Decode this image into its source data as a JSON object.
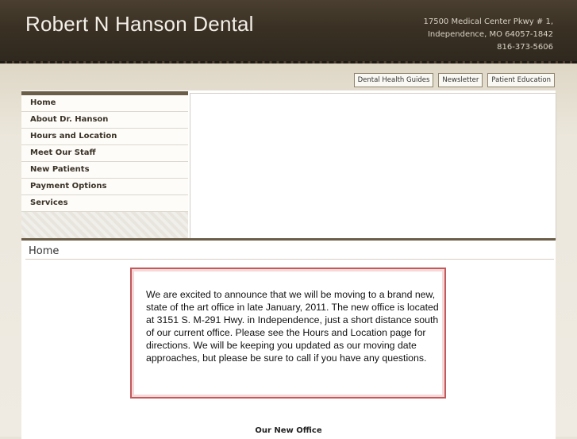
{
  "header": {
    "site_title": "Robert N Hanson Dental",
    "address_line1": "17500 Medical Center Pkwy # 1,",
    "address_line2": "Independence, MO 64057-1842",
    "phone": "816-373-5606"
  },
  "top_links": [
    {
      "label": "Dental Health Guides"
    },
    {
      "label": "Newsletter"
    },
    {
      "label": "Patient Education"
    }
  ],
  "nav": {
    "items": [
      {
        "label": "Home"
      },
      {
        "label": "About Dr. Hanson"
      },
      {
        "label": "Hours and Location"
      },
      {
        "label": "Meet Our Staff"
      },
      {
        "label": "New Patients"
      },
      {
        "label": "Payment Options"
      },
      {
        "label": "Services"
      }
    ]
  },
  "main": {
    "page_title": "Home",
    "notice": "We are excited to announce that we will be moving to a brand new, state of the art office in late January, 2011.  The new office is located at 3151 S. M-291 Hwy. in Independence, just a short distance south of our current office.  Please see the Hours and Location page for directions. We will be keeping you updated as our moving date approaches, but please be sure to call if you have any questions.",
    "next_heading": "Our New Office"
  },
  "colors": {
    "header_bg": "#3a3124",
    "accent_brown": "#6b5e49",
    "notice_border": "#c4585b"
  }
}
